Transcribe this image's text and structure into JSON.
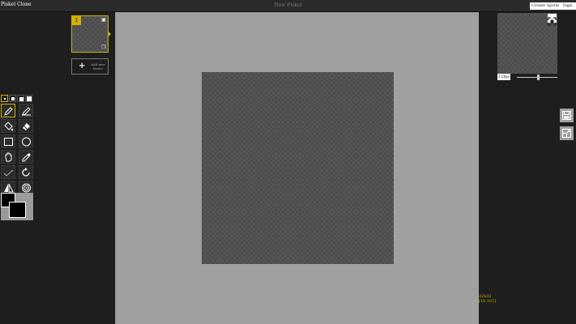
{
  "app": {
    "title": "Piskel Clone",
    "project_name": "New Piskel"
  },
  "topbar": {
    "create_sprite_label": "Create Sprite",
    "signin_label": "Sign in"
  },
  "frames": {
    "items": [
      {
        "number": "1"
      }
    ],
    "add_frame_label": "Add new frame"
  },
  "tools": {
    "pen_sizes": [
      "1",
      "2",
      "3",
      "4"
    ],
    "items": [
      "pen-tool",
      "vertical-mirror-pen-tool",
      "paint-bucket-tool",
      "eraser-tool",
      "rectangle-tool",
      "circle-tool",
      "move-tool",
      "color-picker-tool",
      "lighten-tool",
      "rotate-tool",
      "dithering-tool",
      "spray-tool"
    ]
  },
  "palette": {
    "primary": "#000000",
    "secondary": "#000000"
  },
  "preview": {
    "fps_label": "12fps",
    "fps_value": 12
  },
  "status": {
    "size": "32x32",
    "coords": "[19,101]"
  },
  "colors": {
    "accent": "#d4b000",
    "canvas_bg": "#a0a0a0",
    "panel_bg": "#1e1e1e"
  }
}
